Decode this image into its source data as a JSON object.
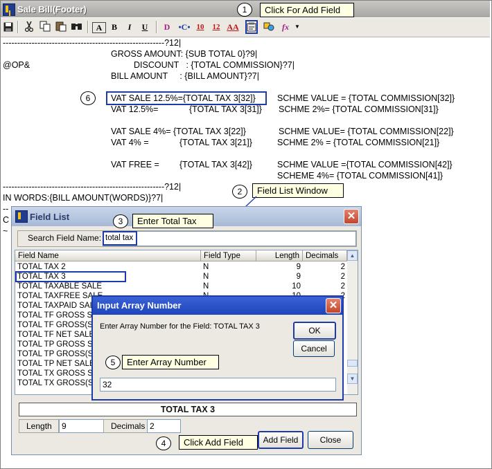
{
  "window": {
    "title": "Sale Bill(Footer)"
  },
  "toolbar": {
    "icons": [
      "save-icon",
      "cut-icon",
      "copy-icon",
      "paste-icon",
      "find-icon",
      "text-box-icon",
      "bold-icon",
      "italic-icon",
      "underline-icon",
      "d-icon",
      "field-icon",
      "font-size-icon",
      "font-size-alt-icon",
      "font-color-icon",
      "add-field-icon",
      "shapes-icon",
      "formula-icon",
      "dropdown-icon"
    ],
    "labels": {
      "text_box": "A",
      "bold": "B",
      "italic": "I",
      "underline": "U",
      "d": "D",
      "font10": "10",
      "font12": "12",
      "fontA": "AA",
      "fx": "fx"
    }
  },
  "callouts": {
    "c1": {
      "num": "1",
      "text": "Click For Add Field"
    },
    "c2": {
      "num": "2",
      "text": "Field List Window"
    },
    "c3": {
      "num": "3",
      "text": "Enter Total Tax"
    },
    "c4": {
      "num": "4",
      "text": "Click Add Field"
    },
    "c5": {
      "num": "5",
      "text": "Enter Array Number"
    },
    "c6": {
      "num": "6"
    }
  },
  "editor": {
    "line1": "--------------------------------------------------------?12|",
    "gross": "GROSS AMOUNT: {SUB TOTAL 0}?9|",
    "op": "@OP&",
    "discount": "DISCOUNT   : {TOTAL COMMISSION}?7|",
    "bill": "BILL AMOUNT     : {BILL AMOUNT}?7|",
    "vat_sale_125": "VAT SALE 12.5%={TOTAL TAX 3[32]}",
    "schme_32": "SCHME VALUE = {TOTAL COMMISSION[32]}",
    "vat_125": "VAT 12.5%=",
    "tax_31": "{TOTAL TAX 3[31]}",
    "schme_31": "SCHME 2%= {TOTAL COMMISSION[31]}",
    "vat_sale_4": "VAT SALE 4%= {TOTAL TAX 3[22]}",
    "schme_22": "SCHME VALUE= {TOTAL COMMISSION[22]}",
    "vat_4": "VAT 4% =",
    "tax_21": "{TOTAL TAX 3[21]}",
    "schme_21": "SCHME 2% = {TOTAL COMMISSION[21]}",
    "vat_free": "VAT FREE =",
    "tax_42": "{TOTAL TAX 3[42]}",
    "schme_42": "SCHME VALUE ={TOTAL COMMISSION[42]}",
    "scheme_41": "SCHEME 4%= {TOTAL COMMISSION[41]}",
    "line2": "--------------------------------------------------------?12|",
    "in_words": "IN WORDS:{BILL AMOUNT(WORDS)}?7|",
    "line3": "--",
    "c_frag": "C",
    "tilde_frag": "~"
  },
  "field_list": {
    "title": "Field List",
    "search_label": "Search Field Name:",
    "search_value": "total tax",
    "columns": [
      "Field Name",
      "Field Type",
      "Length",
      "Decimals"
    ],
    "rows": [
      [
        "TOTAL TAX 2",
        "N",
        "9",
        "2"
      ],
      [
        "TOTAL TAX 3",
        "N",
        "9",
        "2"
      ],
      [
        "TOTAL TAXABLE SALE",
        "N",
        "10",
        "2"
      ],
      [
        "TOTAL TAXFREE SALE",
        "N",
        "10",
        "2"
      ],
      [
        "TOTAL TAXPAID SAL",
        "",
        "",
        ""
      ],
      [
        "TOTAL TF GROSS SA",
        "",
        "",
        ""
      ],
      [
        "TOTAL TF GROSS(S",
        "",
        "",
        ""
      ],
      [
        "TOTAL TF NET SALE",
        "",
        "",
        ""
      ],
      [
        "TOTAL TP GROSS SA",
        "",
        "",
        ""
      ],
      [
        "TOTAL TP GROSS(S",
        "",
        "",
        ""
      ],
      [
        "TOTAL TP NET SALE",
        "",
        "",
        ""
      ],
      [
        "TOTAL TX GROSS SA",
        "",
        "",
        ""
      ],
      [
        "TOTAL TX GROSS(S",
        "",
        "",
        ""
      ]
    ],
    "selected_name": "TOTAL TAX 3",
    "length_label": "Length",
    "length_value": "9",
    "decimals_label": "Decimals",
    "decimals_value": "2",
    "add_button": "Add Field",
    "close_button": "Close"
  },
  "input_dialog": {
    "title": "Input Array Number",
    "prompt": "Enter Array Number for the Field: TOTAL TAX 3",
    "ok": "OK",
    "cancel": "Cancel",
    "value": "32"
  }
}
